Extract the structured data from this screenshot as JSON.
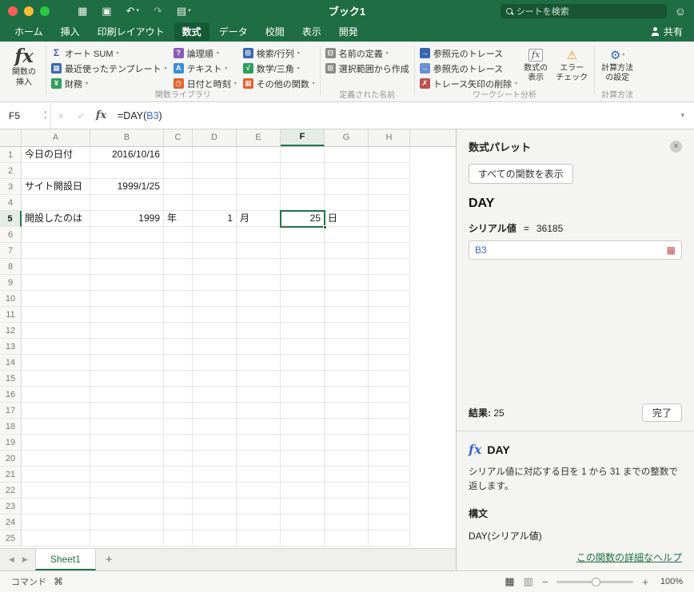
{
  "titlebar": {
    "title": "ブック1",
    "search_placeholder": "シートを検索"
  },
  "tabbar": {
    "tabs": [
      "ホーム",
      "挿入",
      "印刷レイアウト",
      "数式",
      "データ",
      "校閲",
      "表示",
      "開発"
    ],
    "selected": 3,
    "share_label": "共有"
  },
  "ribbon": {
    "insert_function_label": "関数の\n挿入",
    "library": {
      "group_label": "関数ライブラリ",
      "columns": [
        [
          {
            "name": "autosum-button",
            "label": "オート SUM",
            "glyph": "Σ",
            "fg": "#3a66b0",
            "arrow": true
          },
          {
            "name": "recently-used-button",
            "label": "最近使ったテンプレート",
            "glyph": "▦",
            "bg": "#3a66b0",
            "fg": "#ffffff",
            "arrow": true
          },
          {
            "name": "financial-button",
            "label": "財務",
            "glyph": "¥",
            "bg": "#2e9e5b",
            "fg": "#ffffff",
            "arrow": true
          }
        ],
        [
          {
            "name": "logical-button",
            "label": "論理順",
            "glyph": "?",
            "bg": "#8c5bb8",
            "fg": "#ffffff",
            "arrow": true
          },
          {
            "name": "text-button",
            "label": "テキスト",
            "glyph": "A",
            "bg": "#3a8fd9",
            "fg": "#ffffff",
            "arrow": true
          },
          {
            "name": "date-time-button",
            "label": "日付と時刻",
            "glyph": "◷",
            "bg": "#e2622d",
            "fg": "#ffffff",
            "arrow": true
          }
        ],
        [
          {
            "name": "lookup-reference-button",
            "label": "検索/行列",
            "glyph": "⊞",
            "bg": "#3a66b0",
            "fg": "#ffffff",
            "arrow": true
          },
          {
            "name": "math-trig-button",
            "label": "数学/三角",
            "glyph": "√",
            "bg": "#2e9e5b",
            "fg": "#ffffff",
            "arrow": true
          },
          {
            "name": "more-functions-button",
            "label": "その他の関数",
            "glyph": "▦",
            "bg": "#e2622d",
            "fg": "#ffffff",
            "arrow": true
          }
        ]
      ]
    },
    "names": {
      "group_label": "定義された名前",
      "items": [
        {
          "name": "define-name-button",
          "label": "名前の定義",
          "glyph": "⊟",
          "bg": "#8a8a8a",
          "fg": "#ffffff",
          "arrow": true
        },
        {
          "name": "create-from-selection-button",
          "label": "選択範囲から作成",
          "glyph": "⊞",
          "bg": "#8a8a8a",
          "fg": "#ffffff",
          "arrow": false
        }
      ]
    },
    "audit": {
      "group_label": "ワークシート分析",
      "items": [
        {
          "name": "trace-precedents-button",
          "label": "参照元のトレース",
          "glyph": "→",
          "bg": "#3a66b0",
          "fg": "#ffffff",
          "arrow": false
        },
        {
          "name": "trace-dependents-button",
          "label": "参照先のトレース",
          "glyph": "→",
          "bg": "#6b8fd0",
          "fg": "#ffffff",
          "arrow": false
        },
        {
          "name": "remove-arrows-button",
          "label": "トレース矢印の削除",
          "glyph": "✗",
          "bg": "#c0504d",
          "fg": "#ffffff",
          "arrow": true
        }
      ],
      "big_items": [
        {
          "name": "show-formulas-button",
          "label": "数式の\n表示",
          "glyph": "fx",
          "boxed": true
        },
        {
          "name": "error-checking-button",
          "label": "エラー\nチェック",
          "glyph": "⚠",
          "fg": "#e6a30e"
        }
      ]
    },
    "calc": {
      "group_label": "計算方法",
      "item": {
        "name": "calculation-options-button",
        "label": "計算方法\nの設定",
        "glyph": "⚙",
        "fg": "#3a66b0",
        "arrow": true
      }
    }
  },
  "formula_bar": {
    "name_box": "F5",
    "runs": [
      {
        "text": "=DAY(",
        "color": "#222222"
      },
      {
        "text": "B3",
        "color": "#3b6bc6"
      },
      {
        "text": ")",
        "color": "#222222"
      }
    ]
  },
  "grid": {
    "columns": [
      {
        "key": "A",
        "w": 86
      },
      {
        "key": "B",
        "w": 92
      },
      {
        "key": "C",
        "w": 36
      },
      {
        "key": "D",
        "w": 55
      },
      {
        "key": "E",
        "w": 55
      },
      {
        "key": "F",
        "w": 55
      },
      {
        "key": "G",
        "w": 55
      },
      {
        "key": "H",
        "w": 52
      }
    ],
    "row_count": 25,
    "cells": {
      "A1": {
        "t": "今日の日付",
        "a": "l"
      },
      "B1": {
        "t": "2016/10/16",
        "a": "r"
      },
      "A3": {
        "t": "サイト開設日",
        "a": "l"
      },
      "B3": {
        "t": "1999/1/25",
        "a": "r"
      },
      "A5": {
        "t": "開設したのは",
        "a": "l"
      },
      "B5": {
        "t": "1999",
        "a": "r"
      },
      "C5": {
        "t": "年",
        "a": "l"
      },
      "D5": {
        "t": "1",
        "a": "r"
      },
      "E5": {
        "t": "月",
        "a": "l"
      },
      "F5": {
        "t": "25",
        "a": "r"
      },
      "G5": {
        "t": "日",
        "a": "l"
      }
    },
    "selected": {
      "col": "F",
      "row": 5
    }
  },
  "pane": {
    "title": "数式パレット",
    "show_all_button": "すべての関数を表示",
    "function_name": "DAY",
    "arg_name": "シリアル値",
    "equals": "=",
    "arg_serial": "36185",
    "input_value": "B3",
    "result_label": "結果:",
    "result_value": "25",
    "done_button": "完了",
    "help_fx": "fx",
    "help_title": "DAY",
    "help_description": "シリアル値に対応する日を 1 から 31 までの整数で返します。",
    "syntax_label": "構文",
    "syntax": "DAY(シリアル値)",
    "help_link": "この関数の詳細なヘルプ"
  },
  "sheet_bar": {
    "tabs": [
      {
        "name": "Sheet1",
        "active": true
      }
    ],
    "add": "+"
  },
  "status_bar": {
    "mode": "コマンド",
    "zoom": "100%"
  },
  "icons": {
    "apps": "▦",
    "save": "▣",
    "undo": "↶",
    "redo": "↷",
    "print": "▤",
    "dropdown": "▾",
    "smiley": "☺",
    "close_pane": "×",
    "cancel": "×",
    "enter": "✓",
    "fx": "fx",
    "chevron": "▾",
    "tab_left": "◀",
    "tab_right": "▶",
    "minus": "−",
    "plus": "+",
    "view_grid": "▦",
    "view_page": "▥",
    "range": "▦",
    "stepper_up": "▴",
    "stepper_down": "▾",
    "command": "⌘"
  },
  "colors": {
    "excel_green": "#1f6e43",
    "selection_green": "#217346",
    "link_green": "#1e7145",
    "reference_blue": "#3b6bc6"
  }
}
